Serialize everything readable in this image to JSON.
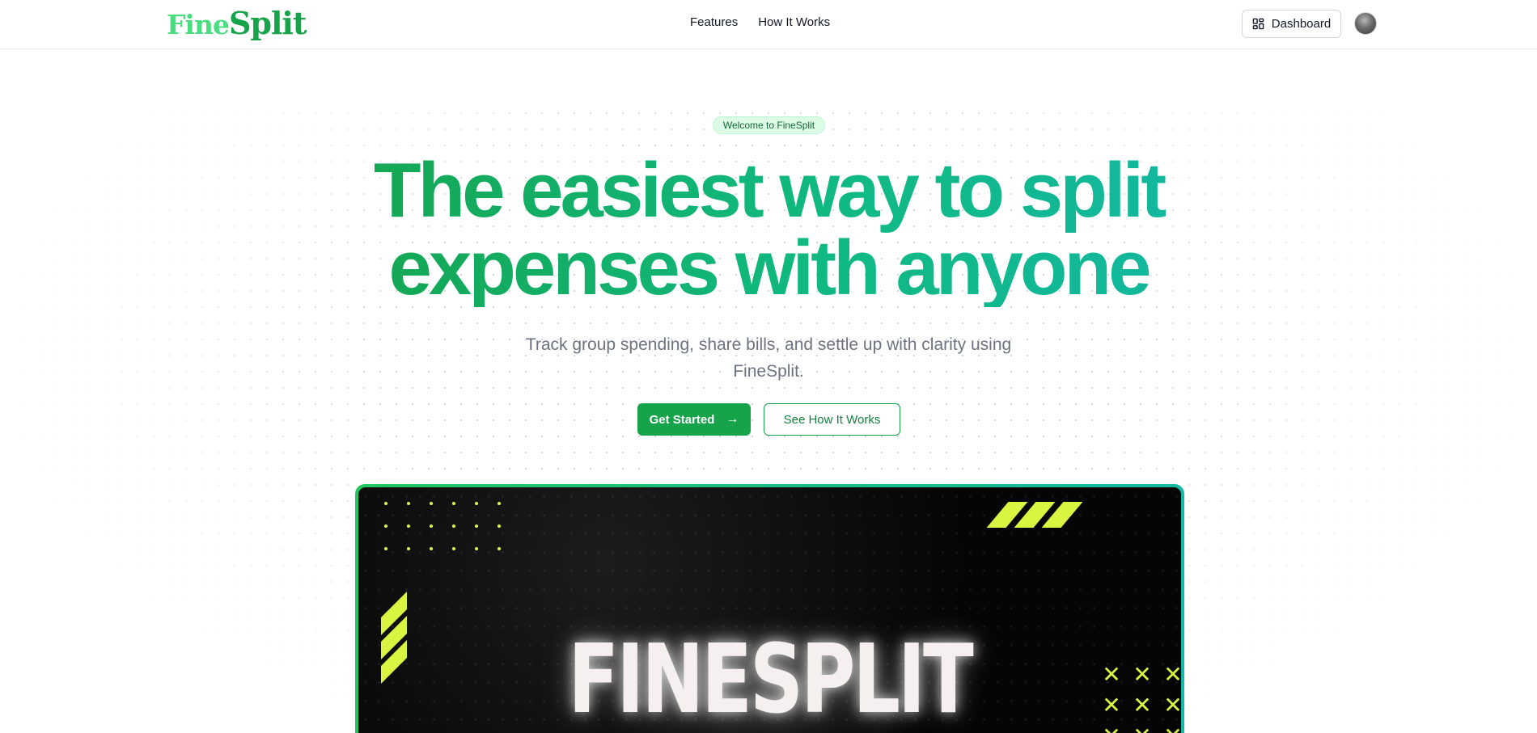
{
  "header": {
    "logo": {
      "part1": "Fine",
      "part2": "Split"
    },
    "nav": [
      {
        "label": "Features"
      },
      {
        "label": "How It Works"
      }
    ],
    "dashboard_label": "Dashboard",
    "dashboard_icon": "layout-grid-icon",
    "avatar_icon": "user-avatar"
  },
  "hero": {
    "badge": "Welcome to FineSplit",
    "headline_line1": "The easiest way to split",
    "headline_line2": "expenses with anyone",
    "subtitle": "Track group spending, share bills, and settle up with clarity using FineSplit.",
    "primary_cta": "Get Started",
    "primary_cta_icon": "arrow-right-icon",
    "secondary_cta": "See How It Works"
  },
  "preview": {
    "title": "FINESPLIT"
  },
  "colors": {
    "brand_green": "#16a34a",
    "accent_teal": "#14b8a6",
    "neon_yellow": "#d9f542"
  }
}
